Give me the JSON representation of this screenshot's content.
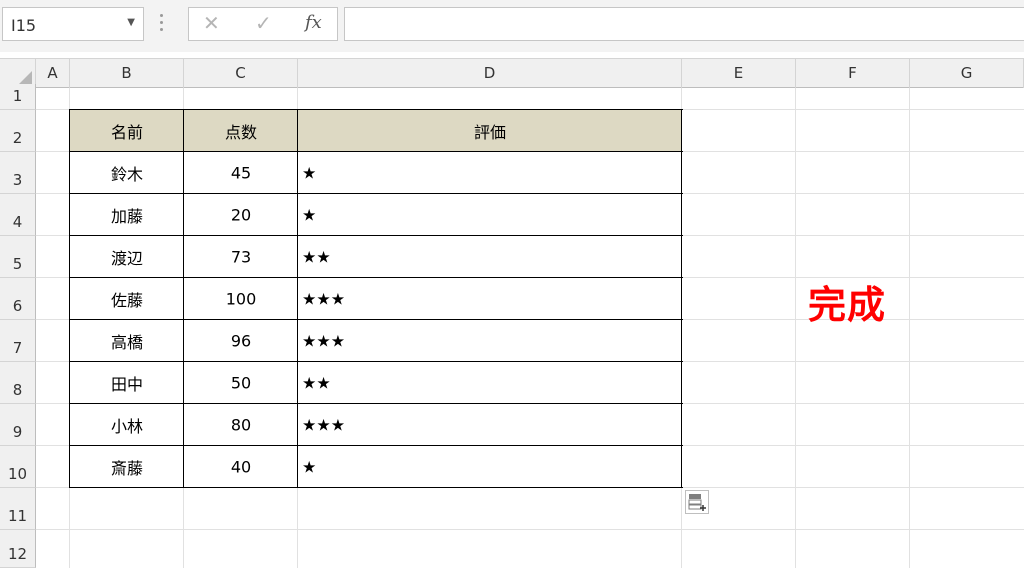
{
  "formula_bar": {
    "name_box": "I15",
    "cancel_glyph": "✕",
    "enter_glyph": "✓",
    "fx_label": "fx",
    "formula": ""
  },
  "columns": [
    "A",
    "B",
    "C",
    "D",
    "E",
    "F",
    "G"
  ],
  "rows": [
    "1",
    "2",
    "3",
    "4",
    "5",
    "6",
    "7",
    "8",
    "9",
    "10",
    "11",
    "12"
  ],
  "table": {
    "headers": [
      "名前",
      "点数",
      "評価"
    ],
    "rows": [
      [
        "鈴木",
        "45",
        "★"
      ],
      [
        "加藤",
        "20",
        "★"
      ],
      [
        "渡辺",
        "73",
        "★★"
      ],
      [
        "佐藤",
        "100",
        "★★★"
      ],
      [
        "高橋",
        "96",
        "★★★"
      ],
      [
        "田中",
        "50",
        "★★"
      ],
      [
        "小林",
        "80",
        "★★★"
      ],
      [
        "斎藤",
        "40",
        "★"
      ]
    ],
    "header_bg": "#ddd9c3"
  },
  "annotation": {
    "text": "完成",
    "color": "#ff0000"
  },
  "icons": {
    "dropdown": "chevron-down-icon",
    "cancel": "cancel-icon",
    "enter": "enter-icon",
    "function": "fx-icon",
    "quick_analysis": "quick-analysis-icon"
  }
}
